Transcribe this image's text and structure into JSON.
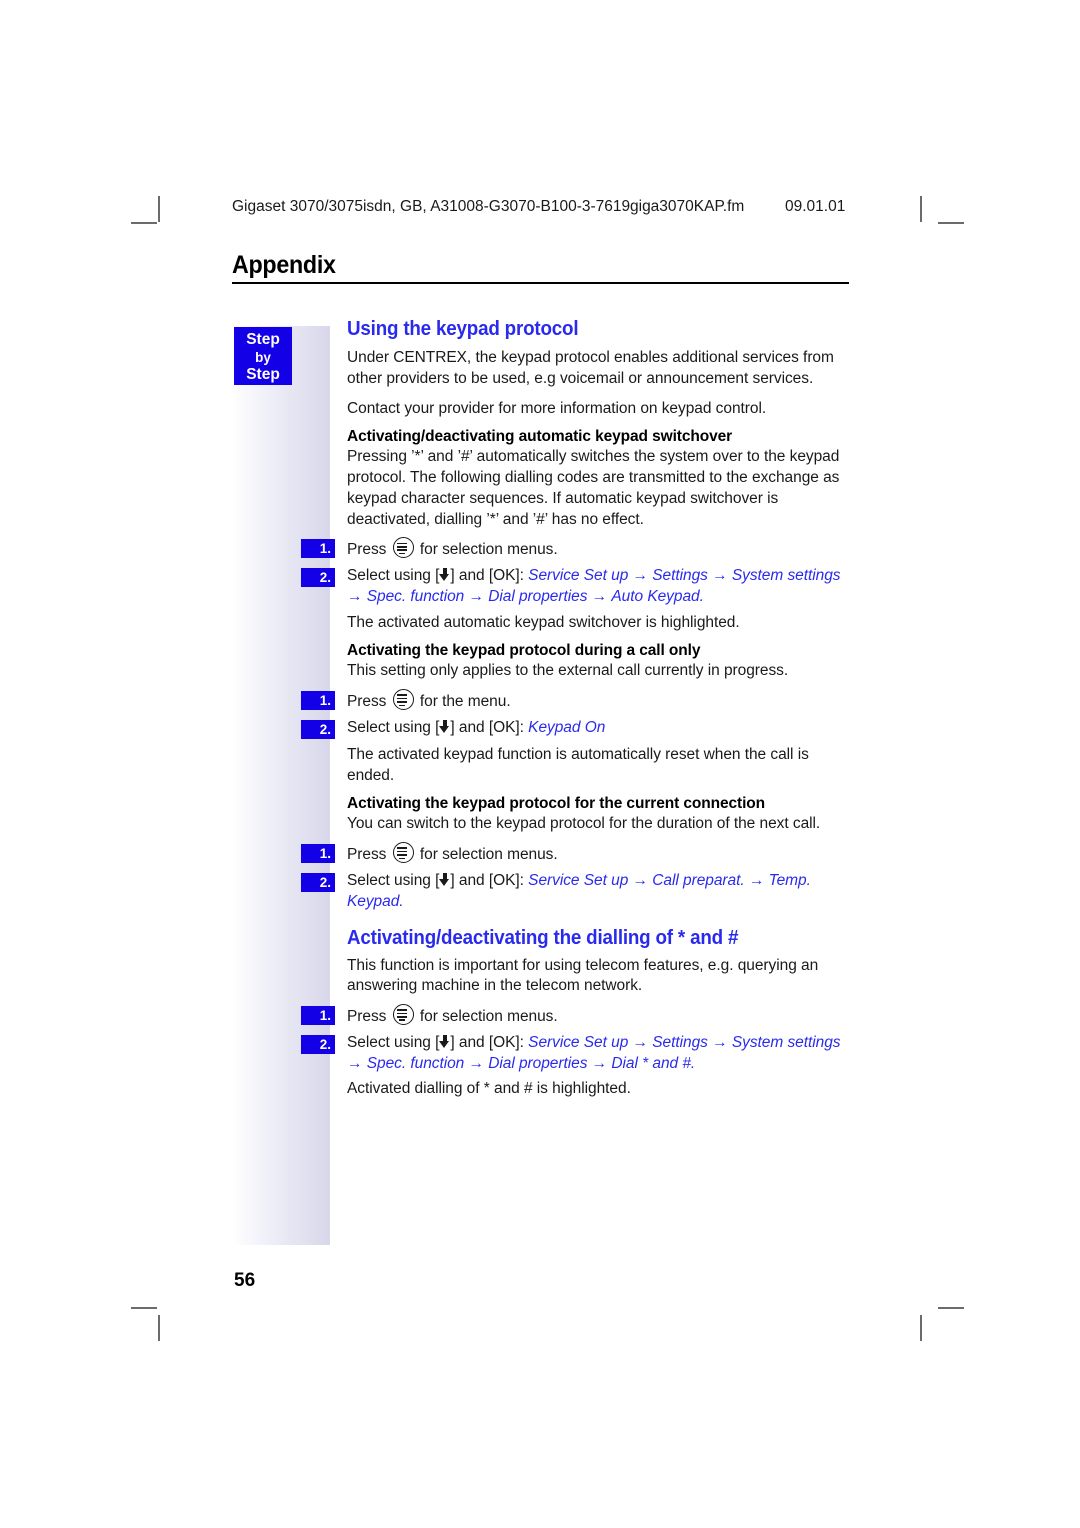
{
  "running_header": {
    "document": "Gigaset 3070/3075isdn, GB, A31008-G3070-B100-3-7619",
    "filename": "giga3070KAP.fm",
    "date": "09.01.01"
  },
  "chapter": {
    "title": "Appendix"
  },
  "sidebar": {
    "badge_line1": "Step",
    "badge_line2": "by",
    "badge_line3": "Step"
  },
  "sections": [
    {
      "heading": "Using the keypad protocol",
      "intro1": "Under CENTREX, the keypad protocol enables additional services from other providers to be used, e.g voicemail or announcement services.",
      "intro2": "Contact your provider for more information on keypad control."
    },
    {
      "heading": "Activating/deactivating the dialling of * and #"
    }
  ],
  "subsections": {
    "auto_switchover": {
      "title": "Activating/deactivating automatic keypad switchover",
      "body": "Pressing ’*’ and ’#’ automatically switches the system over to the keypad protocol. The following dialling codes are transmitted to the exchange as keypad character sequences. If automatic keypad switchover is deactivated, dialling ’*’ and ’#’ has no effect.",
      "step1_num": "1.",
      "step1_pre": "Press",
      "step1_post": "for selection menus.",
      "step2_num": "2.",
      "step2_pre": "Select using [",
      "step2_mid": "] and [OK]:",
      "path": [
        "Service Set up",
        "Settings",
        "System settings",
        "Spec. function",
        "Dial properties",
        "Auto Keypad"
      ],
      "path_terminator": ".",
      "note": "The activated automatic keypad switchover is highlighted."
    },
    "during_call": {
      "title": "Activating the keypad protocol during a call only",
      "body": "This setting only applies to the external call currently in progress.",
      "step1_num": "1.",
      "step1_pre": "Press",
      "step1_post": "for the menu.",
      "step2_num": "2.",
      "step2_pre": "Select using [",
      "step2_mid": "] and [OK]:",
      "path": [
        "Keypad On"
      ],
      "path_terminator": "",
      "note": "The activated keypad function is automatically reset when the call is ended."
    },
    "current_connection": {
      "title": "Activating the keypad protocol for the current connection",
      "body": "You can switch to the keypad protocol for the duration of the next call.",
      "step1_num": "1.",
      "step1_pre": "Press",
      "step1_post": "for selection menus.",
      "step2_num": "2.",
      "step2_pre": "Select using [",
      "step2_mid": "] and [OK]:",
      "path": [
        "Service Set up",
        "Call preparat.",
        "Temp. Keypad"
      ],
      "path_terminator": "."
    },
    "dial_star_hash": {
      "body": "This function is important for using telecom features, e.g. querying an answering machine in the telecom network.",
      "step1_num": "1.",
      "step1_pre": "Press",
      "step1_post": "for selection menus.",
      "step2_num": "2.",
      "step2_pre": "Select using [",
      "step2_mid": "] and [OK]:",
      "path": [
        "Service Set up",
        "Settings",
        "System settings",
        "Spec. function",
        "Dial properties",
        "Dial * and #"
      ],
      "path_terminator": ".",
      "note": "Activated dialling of * and # is highlighted."
    }
  },
  "footer": {
    "page_number": "56"
  },
  "colors": {
    "accent_blue": "#2a2aee",
    "badge_blue": "#1400e6",
    "sidebar_tint": "#d7d7ea"
  }
}
